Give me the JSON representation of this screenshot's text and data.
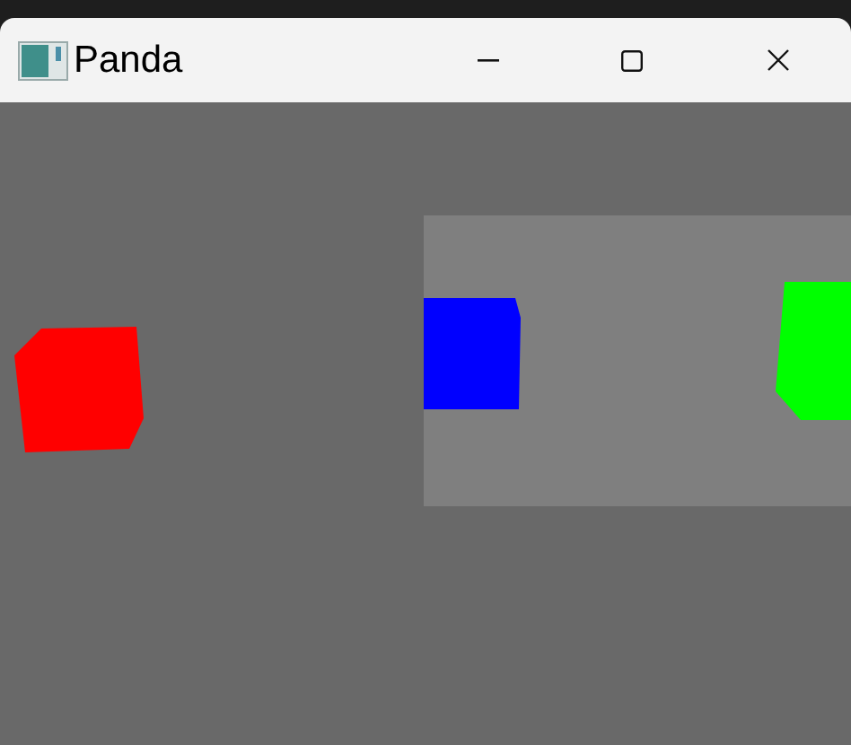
{
  "window": {
    "title": "Panda"
  },
  "scene": {
    "objects": [
      {
        "kind": "region"
      },
      {
        "kind": "cube",
        "color": "#ff0000"
      },
      {
        "kind": "cube",
        "color": "#0000ff"
      },
      {
        "kind": "cube",
        "color": "#00ff00"
      }
    ]
  }
}
